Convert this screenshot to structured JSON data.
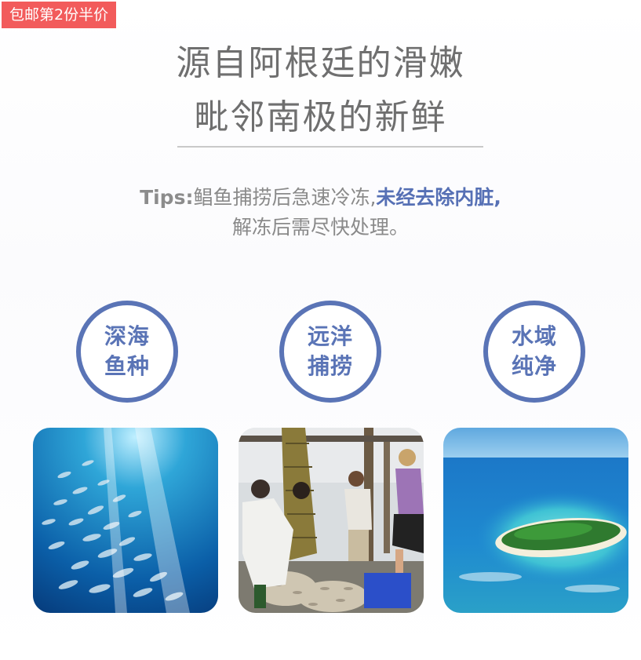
{
  "promo": {
    "badge": "包邮第2份半价"
  },
  "headline": {
    "line1": "源自阿根廷的滑嫩",
    "line2": "毗邻南极的新鲜"
  },
  "tips": {
    "label": "Tips:",
    "text1": "鲳鱼捕捞后急速冷冻,",
    "highlight": "未经去除内脏,",
    "text2": "解冻后需尽快处理。"
  },
  "accent_color": "#5a74b6",
  "badge_color": "#f25b5b",
  "features": [
    {
      "line1": "深海",
      "line2": "鱼种"
    },
    {
      "line1": "远洋",
      "line2": "捕捞"
    },
    {
      "line1": "水域",
      "line2": "纯净"
    }
  ],
  "photos": [
    {
      "subject": "fish-school-underwater-photo"
    },
    {
      "subject": "fishermen-catch-on-deck-photo"
    },
    {
      "subject": "island-in-ocean-aerial-photo"
    }
  ]
}
